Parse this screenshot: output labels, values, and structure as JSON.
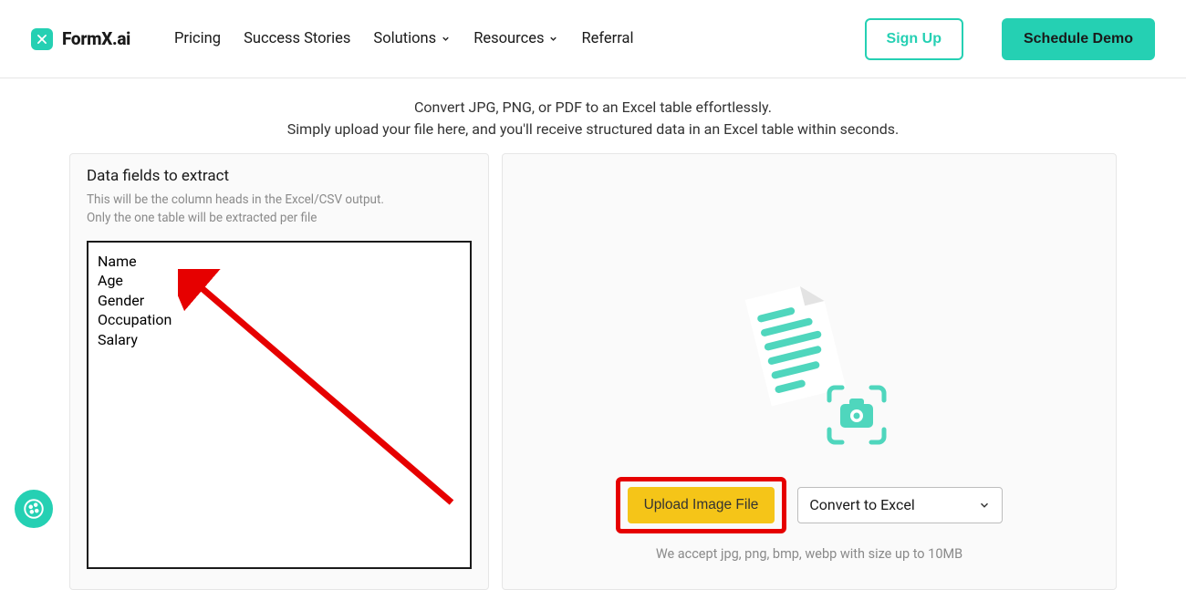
{
  "header": {
    "brand": "FormX.ai",
    "nav": {
      "pricing": "Pricing",
      "success": "Success Stories",
      "solutions": "Solutions",
      "resources": "Resources",
      "referral": "Referral"
    },
    "signup": "Sign Up",
    "demo": "Schedule Demo"
  },
  "hero_line1": "Convert JPG, PNG, or PDF to an Excel table effortlessly.",
  "hero_line2": "Simply upload your file here, and you'll receive structured data in an Excel table within seconds.",
  "fields": {
    "title": "Data fields to extract",
    "hint_line1": "This will be the column heads in the Excel/CSV output.",
    "hint_line2": "Only the one table will be extracted per file",
    "value": "Name\nAge\nGender\nOccupation\nSalary"
  },
  "upload_label": "Upload Image File",
  "convert_selected": "Convert to Excel",
  "accept_note": "We accept jpg, png, bmp, webp with size up to 10MB",
  "colors": {
    "accent": "#25d0b3",
    "annotation": "#e60000",
    "yellow": "#f5c518"
  }
}
